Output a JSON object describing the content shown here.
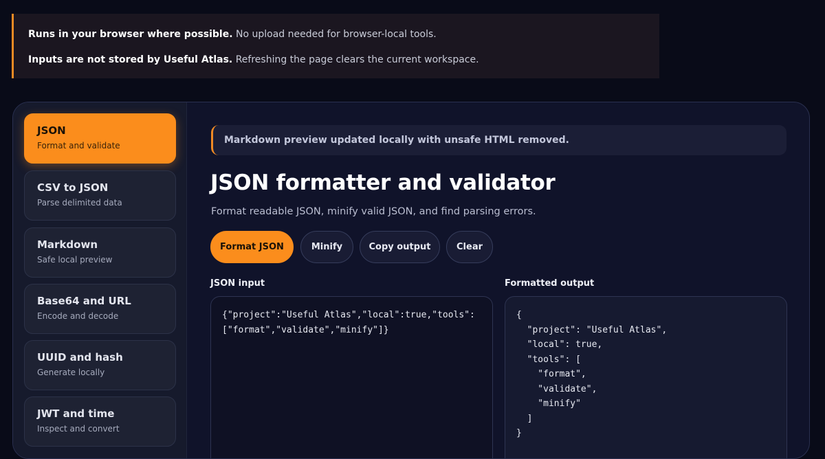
{
  "notice": {
    "line1_bold": "Runs in your browser where possible.",
    "line1_text": " No upload needed for browser-local tools.",
    "line2_bold": "Inputs are not stored by Useful Atlas.",
    "line2_text": " Refreshing the page clears the current workspace."
  },
  "sidebar": {
    "tools": [
      {
        "title": "JSON",
        "subtitle": "Format and validate",
        "active": true
      },
      {
        "title": "CSV to JSON",
        "subtitle": "Parse delimited data"
      },
      {
        "title": "Markdown",
        "subtitle": "Safe local preview"
      },
      {
        "title": "Base64 and URL",
        "subtitle": "Encode and decode"
      },
      {
        "title": "UUID and hash",
        "subtitle": "Generate locally"
      },
      {
        "title": "JWT and time",
        "subtitle": "Inspect and convert"
      }
    ]
  },
  "main": {
    "status_message": "Markdown preview updated locally with unsafe HTML removed.",
    "title": "JSON formatter and validator",
    "description": "Format readable JSON, minify valid JSON, and find parsing errors.",
    "buttons": {
      "format": "Format JSON",
      "minify": "Minify",
      "copy": "Copy output",
      "clear": "Clear"
    },
    "input_label": "JSON input",
    "input_value": "{\"project\":\"Useful Atlas\",\"local\":true,\"tools\":\n[\"format\",\"validate\",\"minify\"]}",
    "output_label": "Formatted output",
    "output_value": "{\n  \"project\": \"Useful Atlas\",\n  \"local\": true,\n  \"tools\": [\n    \"format\",\n    \"validate\",\n    \"minify\"\n  ]\n}"
  },
  "colors": {
    "accent": "#fb8d1c",
    "background": "#090b18",
    "panel": "#10132a"
  }
}
